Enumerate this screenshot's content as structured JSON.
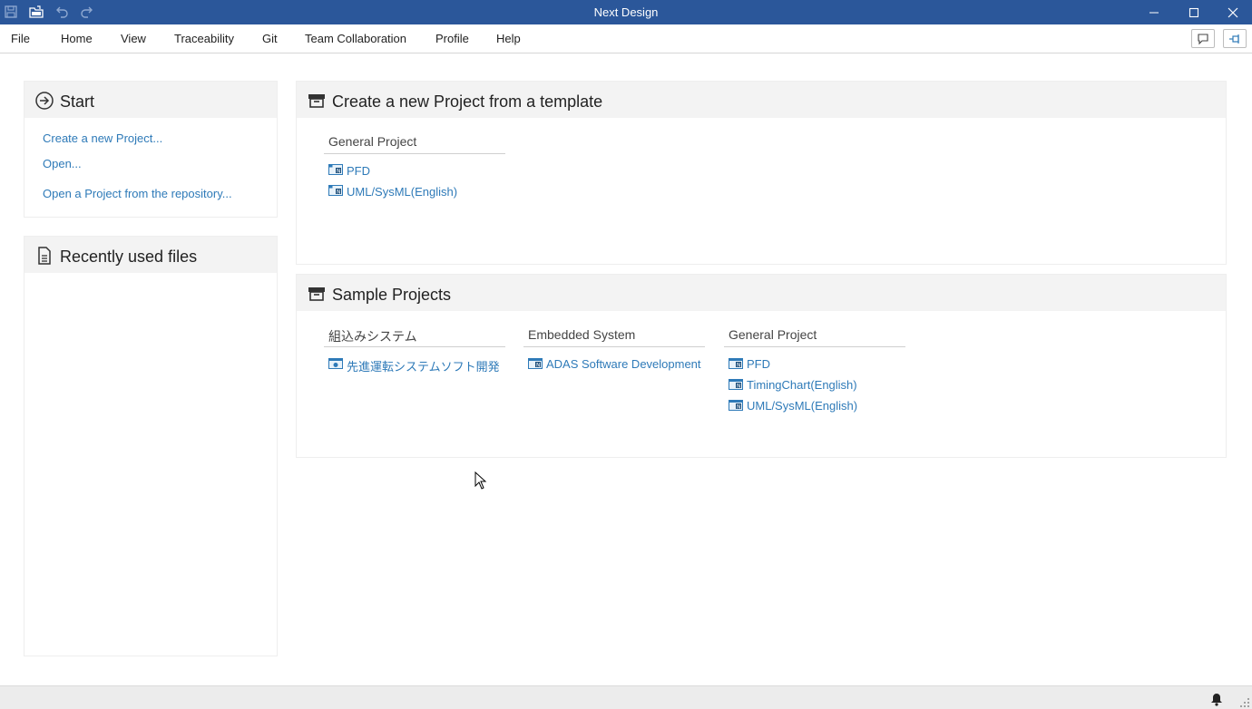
{
  "window": {
    "title": "Next Design"
  },
  "quick_access": [
    "save-icon",
    "open-project-icon",
    "undo-icon",
    "redo-icon"
  ],
  "menu": {
    "items": [
      "File",
      "Home",
      "View",
      "Traceability",
      "Git",
      "Team Collaboration",
      "Profile",
      "Help"
    ],
    "right_buttons": [
      "comment-icon",
      "pin-icon"
    ]
  },
  "start": {
    "title": "Start",
    "links": [
      "Create a new Project...",
      "Open...",
      "Open a Project from the repository..."
    ]
  },
  "recent": {
    "title": "Recently used files"
  },
  "templates": {
    "title": "Create a new Project from a template",
    "groups": [
      {
        "title": "General Project",
        "items": [
          "PFD",
          "UML/SysML(English)"
        ]
      }
    ]
  },
  "samples": {
    "title": "Sample Projects",
    "groups": [
      {
        "title": "組込みシステム",
        "items": [
          "先進運転システムソフト開発"
        ]
      },
      {
        "title": "Embedded System",
        "items": [
          "ADAS Software Development"
        ]
      },
      {
        "title": "General Project",
        "items": [
          "PFD",
          "TimingChart(English)",
          "UML/SysML(English)"
        ]
      }
    ]
  },
  "colors": {
    "titlebar": "#2b579a",
    "link": "#2e7ab8",
    "panel_header": "#f3f3f3"
  }
}
